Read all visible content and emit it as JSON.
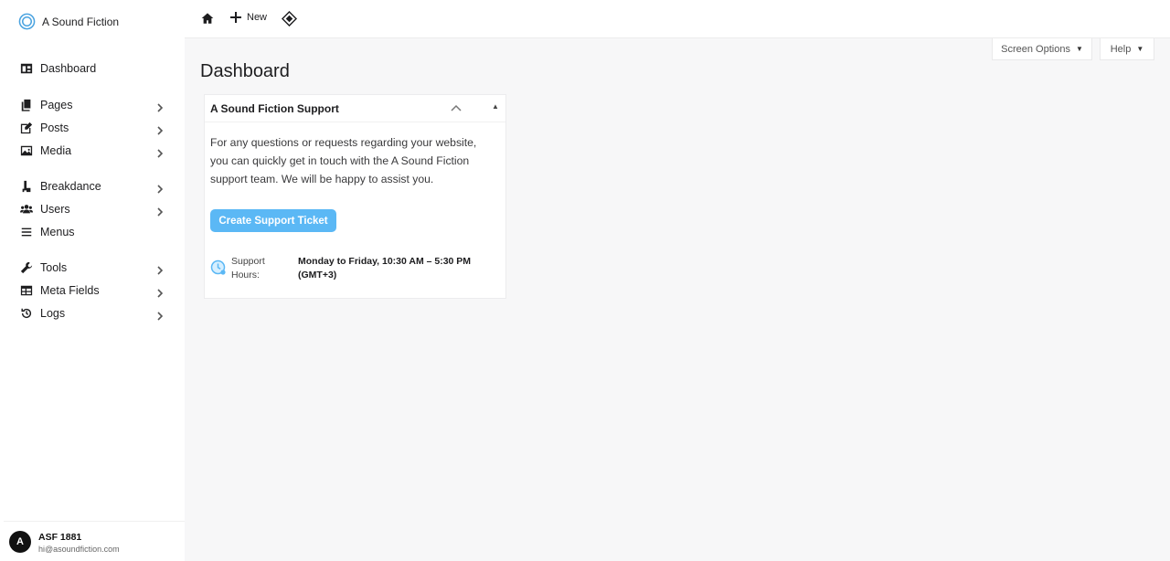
{
  "sidebar": {
    "brand": "A Sound Fiction",
    "items": [
      {
        "label": "Dashboard",
        "icon": "dashboard-icon"
      },
      {
        "label": "Pages",
        "icon": "pages-icon"
      },
      {
        "label": "Posts",
        "icon": "edit-icon"
      },
      {
        "label": "Media",
        "icon": "image-icon"
      },
      {
        "label": "Breakdance",
        "icon": "breakdance-icon"
      },
      {
        "label": "Users",
        "icon": "users-icon"
      },
      {
        "label": "Menus",
        "icon": "menu-icon"
      },
      {
        "label": "Tools",
        "icon": "wrench-icon"
      },
      {
        "label": "Meta Fields",
        "icon": "table-icon"
      },
      {
        "label": "Logs",
        "icon": "history-icon"
      }
    ],
    "user": {
      "initial": "A",
      "name": "ASF 1881",
      "email": "hi@asoundfiction.com"
    }
  },
  "topbar": {
    "new_label": "New"
  },
  "screen_options": {
    "label": "Screen Options"
  },
  "help": {
    "label": "Help"
  },
  "page": {
    "title": "Dashboard"
  },
  "widget": {
    "title": "A Sound Fiction Support",
    "body": "For any questions or requests regarding your website, you can quickly get in touch with the A Sound Fiction support team. We will be happy to assist you.",
    "button_label": "Create Support Ticket",
    "hours_label": "Support Hours:",
    "hours_value": "Monday to Friday, 10:30 AM – 5:30 PM (GMT+3)"
  },
  "colors": {
    "accent": "#5bb8f5",
    "logo": "#4aa3e0"
  }
}
